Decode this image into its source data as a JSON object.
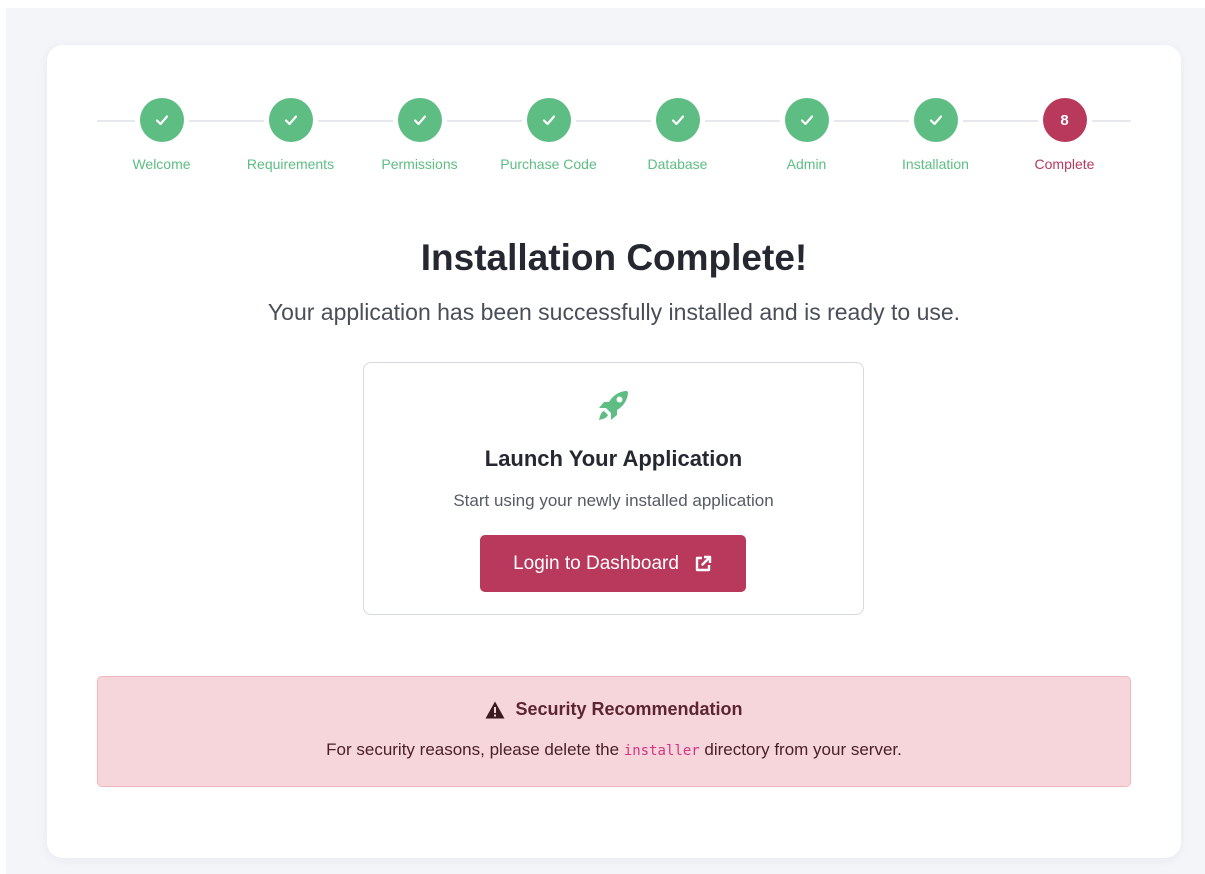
{
  "stepper": {
    "steps": [
      {
        "label": "Welcome",
        "status": "done"
      },
      {
        "label": "Requirements",
        "status": "done"
      },
      {
        "label": "Permissions",
        "status": "done"
      },
      {
        "label": "Purchase Code",
        "status": "done"
      },
      {
        "label": "Database",
        "status": "done"
      },
      {
        "label": "Admin",
        "status": "done"
      },
      {
        "label": "Installation",
        "status": "done"
      },
      {
        "label": "Complete",
        "status": "active",
        "number": "8"
      }
    ]
  },
  "main": {
    "title": "Installation Complete!",
    "subtitle": "Your application has been successfully installed and is ready to use."
  },
  "launch": {
    "icon": "rocket-icon",
    "title": "Launch Your Application",
    "subtitle": "Start using your newly installed application",
    "button_label": "Login to Dashboard",
    "button_icon": "external-link-icon"
  },
  "alert": {
    "icon": "warning-icon",
    "title": "Security Recommendation",
    "text_before": "For security reasons, please delete the",
    "code": "installer",
    "text_after": "directory from your server."
  },
  "colors": {
    "success": "#5dbd83",
    "accent": "#b8395b",
    "alert_bg": "#f7d6db",
    "code": "#d63384"
  }
}
